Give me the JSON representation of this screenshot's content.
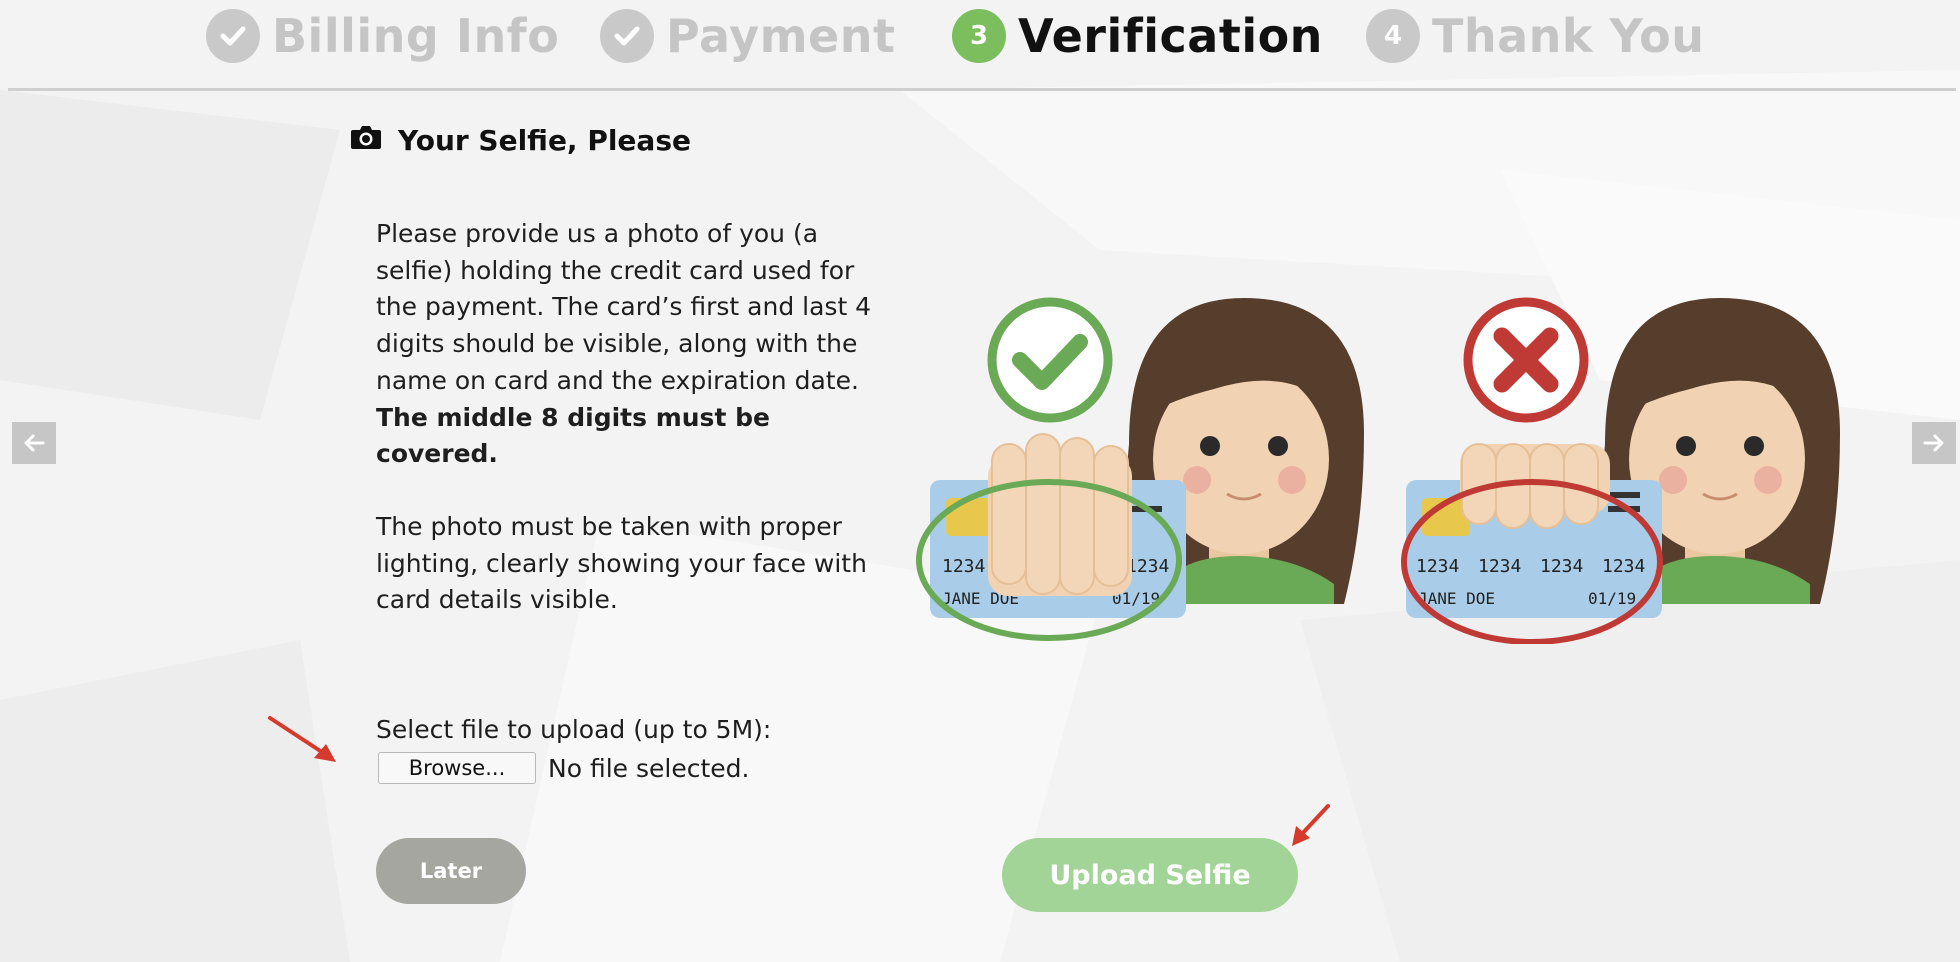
{
  "stepper": {
    "steps": [
      {
        "label": "Billing Info",
        "state": "done",
        "marker": "check"
      },
      {
        "label": "Payment",
        "state": "done",
        "marker": "check"
      },
      {
        "label": "Verification",
        "state": "active",
        "marker": "3"
      },
      {
        "label": "Thank You",
        "state": "pending",
        "marker": "4"
      }
    ]
  },
  "section": {
    "title": "Your Selfie, Please",
    "icon": "camera-icon"
  },
  "instructions": {
    "paragraph1": "Please provide us a photo of you (a selfie) holding the credit card used for the payment. The card’s first and last 4 digits should be visible, along with the name on card and the expiration date.",
    "paragraph1_bold": "The middle 8 digits must be covered.",
    "paragraph2": "The photo must be taken with proper lighting, clearly showing your face with card details visible."
  },
  "upload": {
    "label": "Select file to upload (up to 5M):",
    "browse_label": "Browse...",
    "status": "No file selected."
  },
  "buttons": {
    "later": "Later",
    "upload_selfie": "Upload Selfie"
  },
  "examples": {
    "correct": {
      "card_number": [
        "1234",
        "1234"
      ],
      "card_name": "JANE DOE",
      "card_expiry": "01/19"
    },
    "incorrect": {
      "card_number": [
        "1234",
        "1234",
        "1234",
        "1234"
      ],
      "card_name": "JANE DOE",
      "card_expiry": "01/19"
    }
  },
  "colors": {
    "accent_green": "#7cbd5e",
    "upload_button": "#a2d497",
    "later_button": "#a6a6a0",
    "correct_green": "#6aa955",
    "wrong_red": "#c03a35",
    "hint_arrow_red": "#d63a2c"
  }
}
